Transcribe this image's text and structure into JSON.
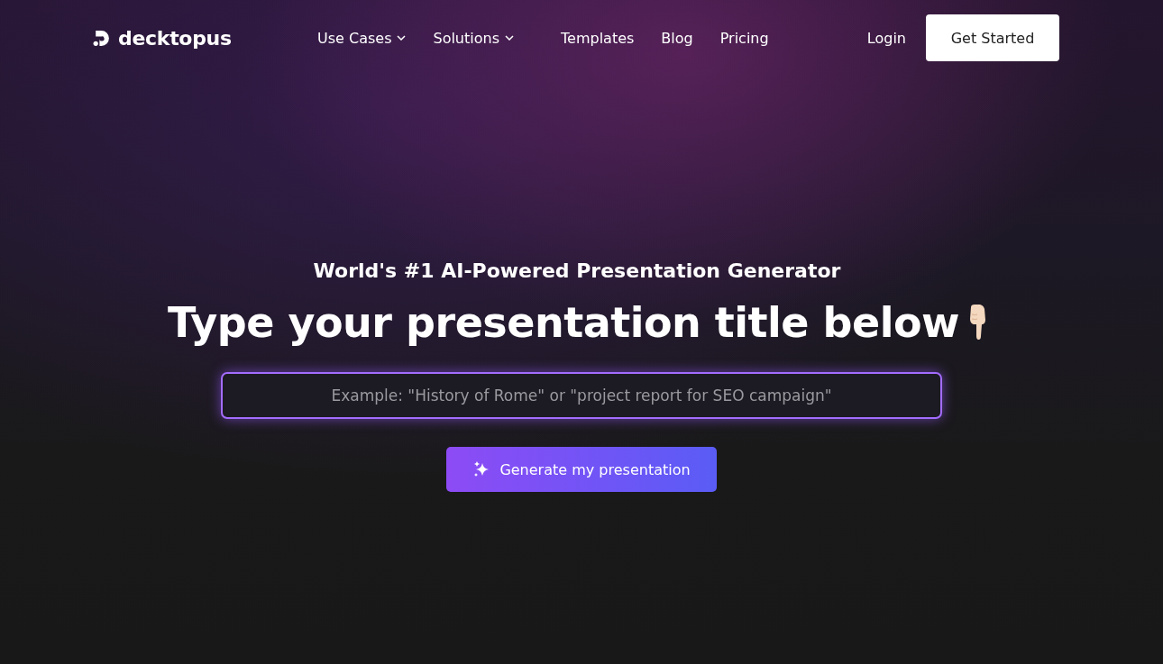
{
  "header": {
    "logo": "decktopus",
    "nav": [
      {
        "label": "Use Cases",
        "dropdown": true
      },
      {
        "label": "Solutions",
        "dropdown": true
      },
      {
        "label": "Templates",
        "dropdown": false
      },
      {
        "label": "Blog",
        "dropdown": false
      },
      {
        "label": "Pricing",
        "dropdown": false
      }
    ],
    "login": "Login",
    "cta": "Get Started"
  },
  "hero": {
    "subtitle": "World's #1 AI-Powered Presentation Generator",
    "title": "Type your presentation title below",
    "input": {
      "placeholder": "Example: \"History of Rome\" or \"project report for SEO campaign\""
    },
    "button": "Generate my presentation"
  }
}
